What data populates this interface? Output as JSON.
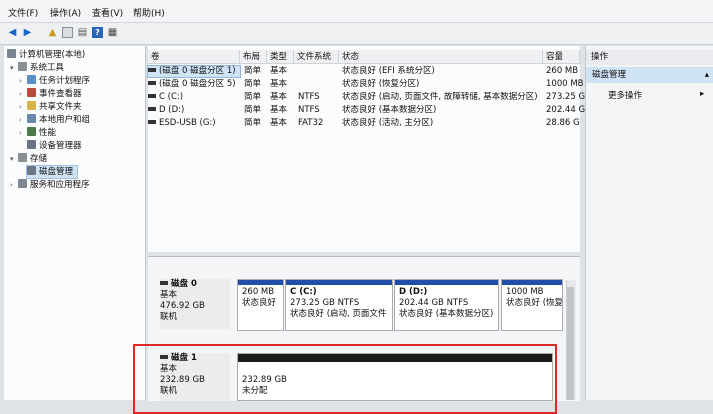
{
  "menu": [
    "文件(F)",
    "操作(A)",
    "查看(V)",
    "帮助(H)"
  ],
  "tree": [
    {
      "label": "计算机管理(本地)",
      "icon": "computer-icon",
      "exp": "",
      "level": 0
    },
    {
      "label": "系统工具",
      "icon": "tools-icon",
      "exp": "▾",
      "level": 1
    },
    {
      "label": "任务计划程序",
      "icon": "clock-icon",
      "exp": "›",
      "level": 2
    },
    {
      "label": "事件查看器",
      "icon": "event-icon",
      "exp": "›",
      "level": 2
    },
    {
      "label": "共享文件夹",
      "icon": "folder-icon",
      "exp": "›",
      "level": 2
    },
    {
      "label": "本地用户和组",
      "icon": "users-icon",
      "exp": "›",
      "level": 2
    },
    {
      "label": "性能",
      "icon": "performance-icon",
      "exp": "›",
      "level": 2
    },
    {
      "label": "设备管理器",
      "icon": "device-icon",
      "exp": "",
      "level": 2
    },
    {
      "label": "存储",
      "icon": "storage-icon",
      "exp": "▾",
      "level": 1
    },
    {
      "label": "磁盘管理",
      "icon": "disk-icon",
      "exp": "",
      "level": 2,
      "selected": true
    },
    {
      "label": "服务和应用程序",
      "icon": "services-icon",
      "exp": "›",
      "level": 1
    }
  ],
  "list": {
    "headers": [
      "卷",
      "布局",
      "类型",
      "文件系统",
      "状态",
      "容量"
    ],
    "rows": [
      {
        "vol": "(磁盘 0 磁盘分区 1)",
        "layout": "简单",
        "type": "基本",
        "fs": "",
        "status": "状态良好 (EFI 系统分区)",
        "size": "260 MB"
      },
      {
        "vol": "(磁盘 0 磁盘分区 5)",
        "layout": "简单",
        "type": "基本",
        "fs": "",
        "status": "状态良好 (恢复分区)",
        "size": "1000 MB"
      },
      {
        "vol": "C (C:)",
        "layout": "简单",
        "type": "基本",
        "fs": "NTFS",
        "status": "状态良好 (启动, 页面文件, 故障转储, 基本数据分区)",
        "size": "273.25 G"
      },
      {
        "vol": "D (D:)",
        "layout": "简单",
        "type": "基本",
        "fs": "NTFS",
        "status": "状态良好 (基本数据分区)",
        "size": "202.44 G"
      },
      {
        "vol": "ESD-USB (G:)",
        "layout": "简单",
        "type": "基本",
        "fs": "FAT32",
        "status": "状态良好 (活动, 主分区)",
        "size": "28.86 G"
      }
    ]
  },
  "disk0": {
    "name": "磁盘 0",
    "type": "基本",
    "size": "476.92 GB",
    "state": "联机",
    "parts": [
      {
        "title": "",
        "line1": "260 MB",
        "line2": "状态良好"
      },
      {
        "title": "C (C:)",
        "line1": "273.25 GB NTFS",
        "line2": "状态良好 (启动, 页面文件"
      },
      {
        "title": "D (D:)",
        "line1": "202.44 GB NTFS",
        "line2": "状态良好 (基本数据分区)"
      },
      {
        "title": "",
        "line1": "1000 MB",
        "line2": "状态良好 (恢复"
      }
    ]
  },
  "disk1": {
    "name": "磁盘 1",
    "type": "基本",
    "size": "232.89 GB",
    "state": "联机",
    "part": {
      "line1": "232.89 GB",
      "line2": "未分配"
    }
  },
  "actions": {
    "header": "操作",
    "selected": "磁盘管理",
    "more": "更多操作"
  },
  "colors": {
    "partition_bar": "#1f4fa8",
    "unallocated_bar": "#1a1a1a",
    "highlight": "#e02828"
  }
}
